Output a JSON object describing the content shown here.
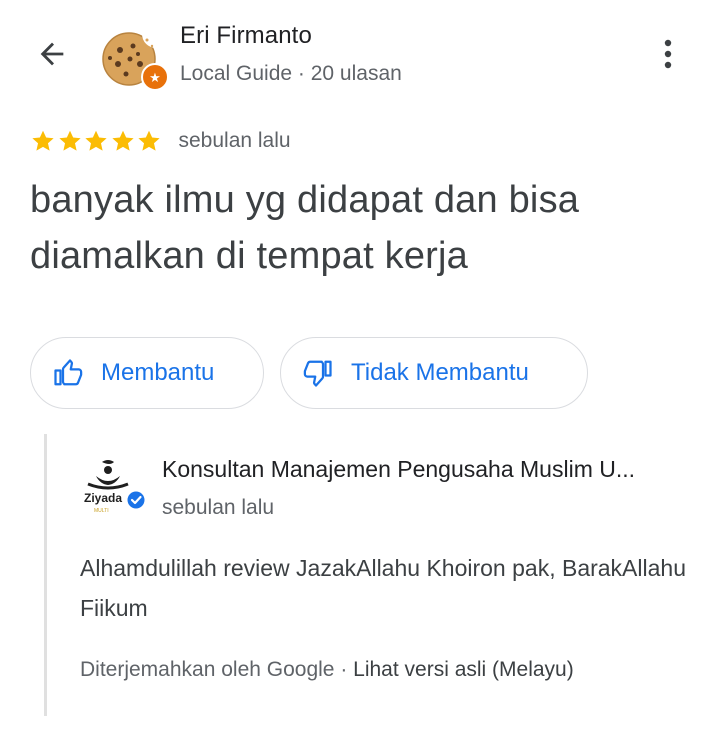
{
  "header": {
    "back_icon": "arrow-left-icon",
    "user_name": "Eri Firmanto",
    "user_meta": "Local Guide · 20 ulasan",
    "avatar": "cookie-avatar",
    "badge_icon": "local-guide-star-badge",
    "more_icon": "more-vert-icon"
  },
  "review": {
    "rating": 5,
    "rating_max": 5,
    "time": "sebulan lalu",
    "text": "banyak ilmu yg didapat dan bisa diamalkan di tempat kerja"
  },
  "actions": {
    "helpful_label": "Membantu",
    "not_helpful_label": "Tidak Membantu"
  },
  "owner_reply": {
    "owner_name": "Konsultan Manajemen Pengusaha Muslim U...",
    "logo_text": "Ziyada",
    "verified_icon": "verified-check-icon",
    "time": "sebulan lalu",
    "text": "Alhamdulillah review JazakAllahu Khoiron pak, BarakAllahu Fiikum",
    "translated_by": "Diterjemahkan oleh Google · ",
    "original_link": "Lihat versi asli (Melayu)"
  },
  "colors": {
    "accent": "#1a73e8",
    "star": "#fbbc04",
    "badge": "#e8710a",
    "muted_text": "#5f6368"
  }
}
